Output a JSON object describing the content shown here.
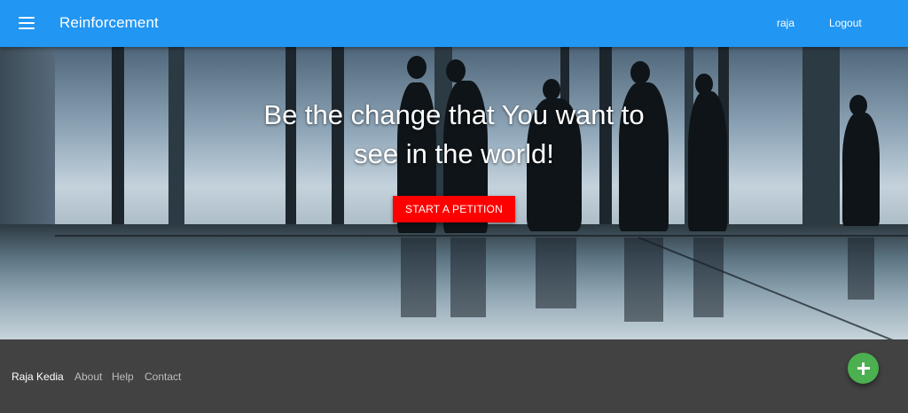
{
  "appbar": {
    "title": "Reinforcement",
    "menu_icon": "hamburger-menu-icon",
    "user": "raja",
    "logout": "Logout",
    "color": "#2196f3"
  },
  "hero": {
    "headline": "Be the change that You want to see in the world!",
    "cta_label": "START A PETITION",
    "cta_color": "#ff0000"
  },
  "footer": {
    "links": [
      "Raja Kedia",
      "About",
      "Help",
      "Contact"
    ],
    "fab_icon": "plus-icon",
    "fab_color": "#4caf50"
  }
}
